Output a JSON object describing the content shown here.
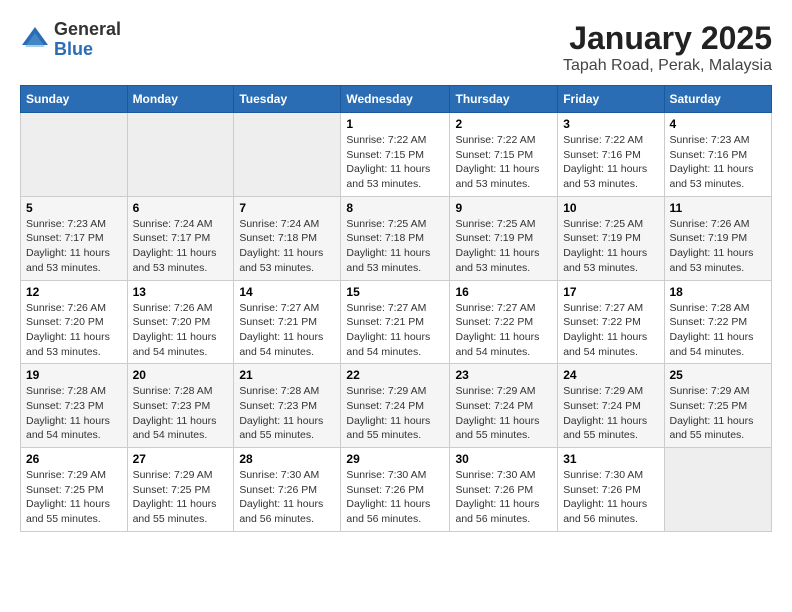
{
  "logo": {
    "general": "General",
    "blue": "Blue"
  },
  "title": "January 2025",
  "subtitle": "Tapah Road, Perak, Malaysia",
  "headers": [
    "Sunday",
    "Monday",
    "Tuesday",
    "Wednesday",
    "Thursday",
    "Friday",
    "Saturday"
  ],
  "weeks": [
    [
      {
        "day": "",
        "info": ""
      },
      {
        "day": "",
        "info": ""
      },
      {
        "day": "",
        "info": ""
      },
      {
        "day": "1",
        "info": "Sunrise: 7:22 AM\nSunset: 7:15 PM\nDaylight: 11 hours and 53 minutes."
      },
      {
        "day": "2",
        "info": "Sunrise: 7:22 AM\nSunset: 7:15 PM\nDaylight: 11 hours and 53 minutes."
      },
      {
        "day": "3",
        "info": "Sunrise: 7:22 AM\nSunset: 7:16 PM\nDaylight: 11 hours and 53 minutes."
      },
      {
        "day": "4",
        "info": "Sunrise: 7:23 AM\nSunset: 7:16 PM\nDaylight: 11 hours and 53 minutes."
      }
    ],
    [
      {
        "day": "5",
        "info": "Sunrise: 7:23 AM\nSunset: 7:17 PM\nDaylight: 11 hours and 53 minutes."
      },
      {
        "day": "6",
        "info": "Sunrise: 7:24 AM\nSunset: 7:17 PM\nDaylight: 11 hours and 53 minutes."
      },
      {
        "day": "7",
        "info": "Sunrise: 7:24 AM\nSunset: 7:18 PM\nDaylight: 11 hours and 53 minutes."
      },
      {
        "day": "8",
        "info": "Sunrise: 7:25 AM\nSunset: 7:18 PM\nDaylight: 11 hours and 53 minutes."
      },
      {
        "day": "9",
        "info": "Sunrise: 7:25 AM\nSunset: 7:19 PM\nDaylight: 11 hours and 53 minutes."
      },
      {
        "day": "10",
        "info": "Sunrise: 7:25 AM\nSunset: 7:19 PM\nDaylight: 11 hours and 53 minutes."
      },
      {
        "day": "11",
        "info": "Sunrise: 7:26 AM\nSunset: 7:19 PM\nDaylight: 11 hours and 53 minutes."
      }
    ],
    [
      {
        "day": "12",
        "info": "Sunrise: 7:26 AM\nSunset: 7:20 PM\nDaylight: 11 hours and 53 minutes."
      },
      {
        "day": "13",
        "info": "Sunrise: 7:26 AM\nSunset: 7:20 PM\nDaylight: 11 hours and 54 minutes."
      },
      {
        "day": "14",
        "info": "Sunrise: 7:27 AM\nSunset: 7:21 PM\nDaylight: 11 hours and 54 minutes."
      },
      {
        "day": "15",
        "info": "Sunrise: 7:27 AM\nSunset: 7:21 PM\nDaylight: 11 hours and 54 minutes."
      },
      {
        "day": "16",
        "info": "Sunrise: 7:27 AM\nSunset: 7:22 PM\nDaylight: 11 hours and 54 minutes."
      },
      {
        "day": "17",
        "info": "Sunrise: 7:27 AM\nSunset: 7:22 PM\nDaylight: 11 hours and 54 minutes."
      },
      {
        "day": "18",
        "info": "Sunrise: 7:28 AM\nSunset: 7:22 PM\nDaylight: 11 hours and 54 minutes."
      }
    ],
    [
      {
        "day": "19",
        "info": "Sunrise: 7:28 AM\nSunset: 7:23 PM\nDaylight: 11 hours and 54 minutes."
      },
      {
        "day": "20",
        "info": "Sunrise: 7:28 AM\nSunset: 7:23 PM\nDaylight: 11 hours and 54 minutes."
      },
      {
        "day": "21",
        "info": "Sunrise: 7:28 AM\nSunset: 7:23 PM\nDaylight: 11 hours and 55 minutes."
      },
      {
        "day": "22",
        "info": "Sunrise: 7:29 AM\nSunset: 7:24 PM\nDaylight: 11 hours and 55 minutes."
      },
      {
        "day": "23",
        "info": "Sunrise: 7:29 AM\nSunset: 7:24 PM\nDaylight: 11 hours and 55 minutes."
      },
      {
        "day": "24",
        "info": "Sunrise: 7:29 AM\nSunset: 7:24 PM\nDaylight: 11 hours and 55 minutes."
      },
      {
        "day": "25",
        "info": "Sunrise: 7:29 AM\nSunset: 7:25 PM\nDaylight: 11 hours and 55 minutes."
      }
    ],
    [
      {
        "day": "26",
        "info": "Sunrise: 7:29 AM\nSunset: 7:25 PM\nDaylight: 11 hours and 55 minutes."
      },
      {
        "day": "27",
        "info": "Sunrise: 7:29 AM\nSunset: 7:25 PM\nDaylight: 11 hours and 55 minutes."
      },
      {
        "day": "28",
        "info": "Sunrise: 7:30 AM\nSunset: 7:26 PM\nDaylight: 11 hours and 56 minutes."
      },
      {
        "day": "29",
        "info": "Sunrise: 7:30 AM\nSunset: 7:26 PM\nDaylight: 11 hours and 56 minutes."
      },
      {
        "day": "30",
        "info": "Sunrise: 7:30 AM\nSunset: 7:26 PM\nDaylight: 11 hours and 56 minutes."
      },
      {
        "day": "31",
        "info": "Sunrise: 7:30 AM\nSunset: 7:26 PM\nDaylight: 11 hours and 56 minutes."
      },
      {
        "day": "",
        "info": ""
      }
    ]
  ]
}
